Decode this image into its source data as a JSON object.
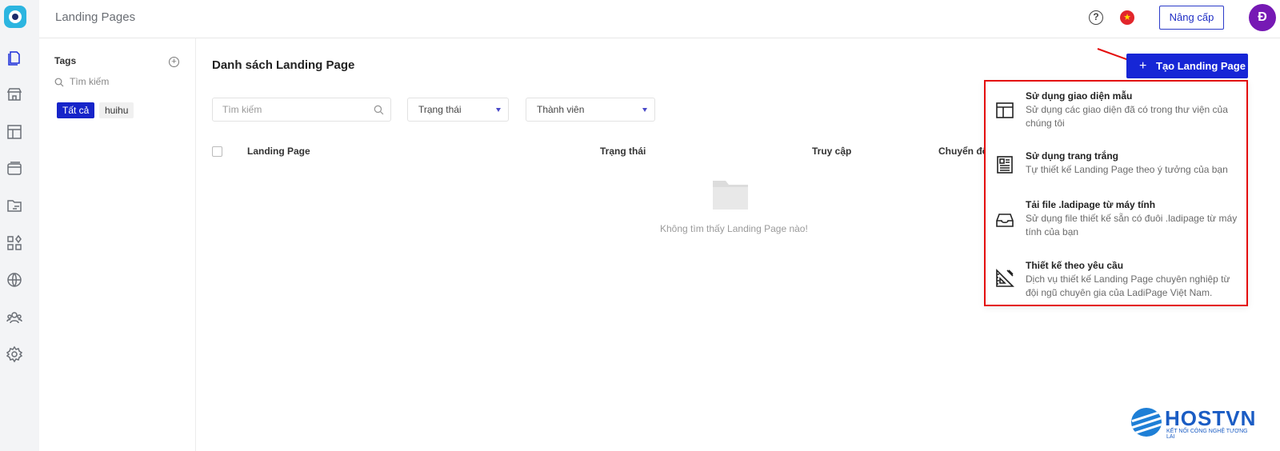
{
  "app": {
    "title": "Landing Pages"
  },
  "topbar": {
    "upgrade_label": "Nâng cấp",
    "avatar_initial": "Đ",
    "help_glyph": "?",
    "flag_glyph": "★"
  },
  "tags": {
    "title": "Tags",
    "search_placeholder": "Tìm kiếm",
    "chips": [
      "Tất cả",
      "huihu"
    ],
    "add_glyph": "+"
  },
  "main": {
    "title": "Danh sách Landing Page",
    "search_placeholder": "Tìm kiếm",
    "status_filter": "Trạng thái",
    "member_filter": "Thành viên",
    "columns": [
      "Landing Page",
      "Trạng thái",
      "Truy cập",
      "Chuyển đổ"
    ],
    "empty_message": "Không tìm thấy Landing Page nào!"
  },
  "create_button": {
    "label": "Tạo Landing Page",
    "plus": "+"
  },
  "create_menu": [
    {
      "title": "Sử dụng giao diện mẫu",
      "desc": "Sử dụng các giao diện đã có trong thư viện của chúng tôi",
      "icon": "layout-template-icon"
    },
    {
      "title": "Sử dụng trang trắng",
      "desc": "Tự thiết kế Landing Page theo ý tưởng của bạn",
      "icon": "blank-page-icon"
    },
    {
      "title": "Tải file .ladipage từ máy tính",
      "desc": "Sử dụng file thiết kế sẵn có đuôi .ladipage từ máy tính của bạn",
      "icon": "inbox-upload-icon"
    },
    {
      "title": "Thiết kế theo yêu cầu",
      "desc": "Dịch vụ thiết kế Landing Page chuyên nghiệp từ đội ngũ chuyên gia của LadiPage Việt Nam.",
      "icon": "design-ruler-icon"
    }
  ],
  "watermark": {
    "name": "HOSTVN",
    "tagline": "KẾT NỐI CÔNG NGHỆ TƯƠNG LAI"
  },
  "colors": {
    "accent": "#1626d6",
    "highlight": "#e40d0d",
    "avatar": "#7619b4"
  },
  "sidebar": {
    "icons": [
      "pages-icon",
      "store-icon",
      "layout-icon",
      "browser-icon",
      "folder-sync-icon",
      "apps-icon",
      "globe-icon",
      "team-icon",
      "settings-icon"
    ]
  }
}
